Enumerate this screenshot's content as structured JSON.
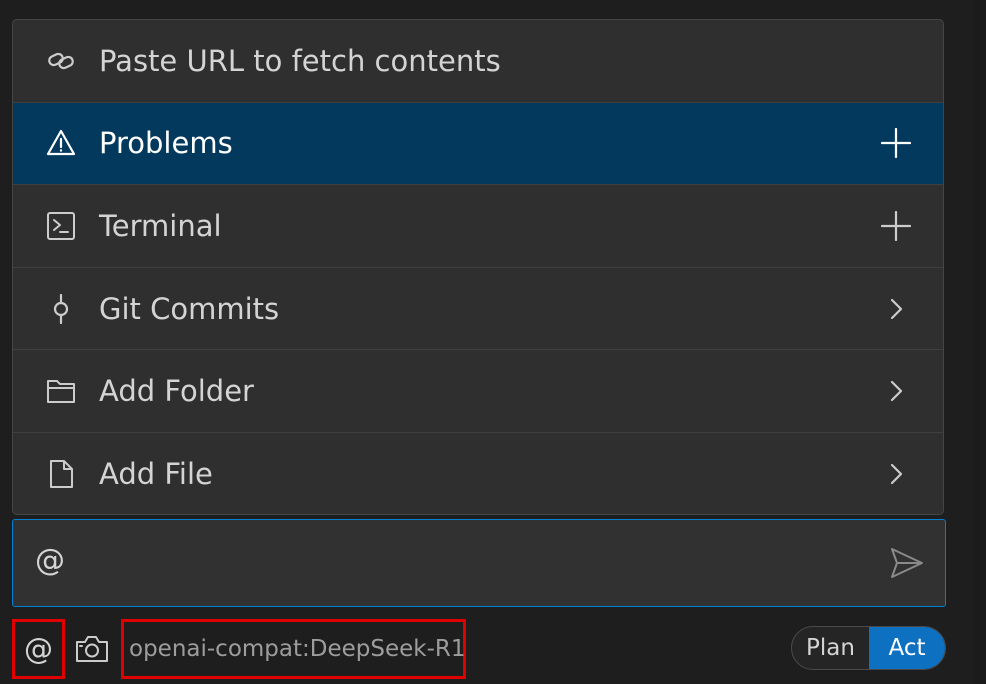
{
  "menu": {
    "items": [
      {
        "label": "Paste URL to fetch contents",
        "icon": "link-icon",
        "action": "none",
        "selected": false
      },
      {
        "label": "Problems",
        "icon": "warning-icon",
        "action": "plus-icon",
        "selected": true
      },
      {
        "label": "Terminal",
        "icon": "terminal-icon",
        "action": "plus-icon",
        "selected": false
      },
      {
        "label": "Git Commits",
        "icon": "git-commit-icon",
        "action": "chevron-right-icon",
        "selected": false
      },
      {
        "label": "Add Folder",
        "icon": "folder-icon",
        "action": "chevron-right-icon",
        "selected": false
      },
      {
        "label": "Add File",
        "icon": "file-icon",
        "action": "chevron-right-icon",
        "selected": false
      }
    ]
  },
  "input": {
    "value": "@",
    "send_icon": "send-icon"
  },
  "toolbar": {
    "mention_label": "@",
    "camera_icon": "camera-icon",
    "model_label": "openai-compat:DeepSeek-R1",
    "mode": {
      "plan_label": "Plan",
      "act_label": "Act",
      "active": "Act"
    }
  },
  "colors": {
    "background": "#1e1e1e",
    "menu_bg": "#2f2f2f",
    "selected_bg": "#04395e",
    "accent": "#0e70c0",
    "focus_border": "#007fd4",
    "highlight_box": "#e00000"
  }
}
